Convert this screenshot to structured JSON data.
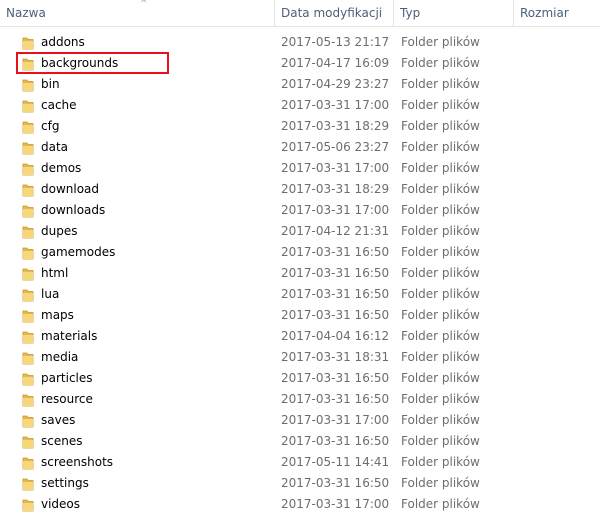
{
  "columns": {
    "name": "Nazwa",
    "date": "Data modyfikacji",
    "type": "Typ",
    "size": "Rozmiar"
  },
  "highlight_color": "#e8101a",
  "folder_icon": "folder-icon",
  "rows": [
    {
      "name": "addons",
      "date": "2017-05-13 21:17",
      "type": "Folder plików",
      "size": ""
    },
    {
      "name": "backgrounds",
      "date": "2017-04-17 16:09",
      "type": "Folder plików",
      "size": "",
      "highlighted": true
    },
    {
      "name": "bin",
      "date": "2017-04-29 23:27",
      "type": "Folder plików",
      "size": ""
    },
    {
      "name": "cache",
      "date": "2017-03-31 17:00",
      "type": "Folder plików",
      "size": ""
    },
    {
      "name": "cfg",
      "date": "2017-03-31 18:29",
      "type": "Folder plików",
      "size": ""
    },
    {
      "name": "data",
      "date": "2017-05-06 23:27",
      "type": "Folder plików",
      "size": ""
    },
    {
      "name": "demos",
      "date": "2017-03-31 17:00",
      "type": "Folder plików",
      "size": ""
    },
    {
      "name": "download",
      "date": "2017-03-31 18:29",
      "type": "Folder plików",
      "size": ""
    },
    {
      "name": "downloads",
      "date": "2017-03-31 17:00",
      "type": "Folder plików",
      "size": ""
    },
    {
      "name": "dupes",
      "date": "2017-04-12 21:31",
      "type": "Folder plików",
      "size": ""
    },
    {
      "name": "gamemodes",
      "date": "2017-03-31 16:50",
      "type": "Folder plików",
      "size": ""
    },
    {
      "name": "html",
      "date": "2017-03-31 16:50",
      "type": "Folder plików",
      "size": ""
    },
    {
      "name": "lua",
      "date": "2017-03-31 16:50",
      "type": "Folder plików",
      "size": ""
    },
    {
      "name": "maps",
      "date": "2017-03-31 16:50",
      "type": "Folder plików",
      "size": ""
    },
    {
      "name": "materials",
      "date": "2017-04-04 16:12",
      "type": "Folder plików",
      "size": ""
    },
    {
      "name": "media",
      "date": "2017-03-31 18:31",
      "type": "Folder plików",
      "size": ""
    },
    {
      "name": "particles",
      "date": "2017-03-31 16:50",
      "type": "Folder plików",
      "size": ""
    },
    {
      "name": "resource",
      "date": "2017-03-31 16:50",
      "type": "Folder plików",
      "size": ""
    },
    {
      "name": "saves",
      "date": "2017-03-31 17:00",
      "type": "Folder plików",
      "size": ""
    },
    {
      "name": "scenes",
      "date": "2017-03-31 16:50",
      "type": "Folder plików",
      "size": ""
    },
    {
      "name": "screenshots",
      "date": "2017-05-11 14:41",
      "type": "Folder plików",
      "size": ""
    },
    {
      "name": "settings",
      "date": "2017-03-31 16:50",
      "type": "Folder plików",
      "size": ""
    },
    {
      "name": "videos",
      "date": "2017-03-31 17:00",
      "type": "Folder plików",
      "size": ""
    }
  ]
}
